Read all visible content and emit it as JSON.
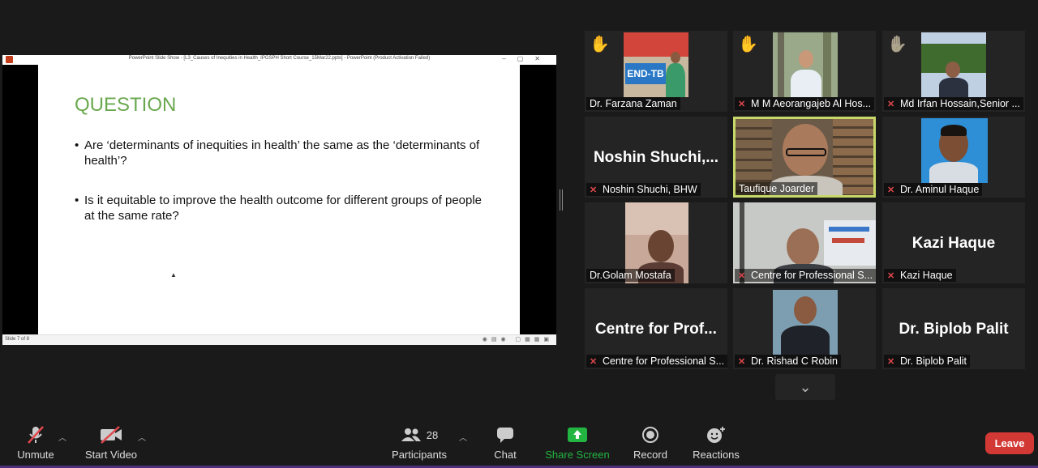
{
  "share": {
    "window_title": "PowerPoint Slide Show - [L3_Causes of Inequities in Health_IPGSPH Short Course_15Mar22.pptx] - PowerPoint (Product Activation Failed)",
    "slide_heading": "QUESTION",
    "bullets": [
      "Are ‘determinants of inequities in health’ the same as the ‘determinants of health’?",
      "Is it equitable to improve the health outcome for different groups of people at the same rate?"
    ],
    "slide_status": "Slide 7 of 8"
  },
  "gallery": {
    "tiles": [
      {
        "name": "Dr. Farzana Zaman",
        "muted": false,
        "hand": true,
        "big_name": ""
      },
      {
        "name": "M M Aeorangajeb Al Hos...",
        "muted": true,
        "hand": true,
        "big_name": ""
      },
      {
        "name": "Md Irfan Hossain,Senior ...",
        "muted": true,
        "hand": true,
        "big_name": ""
      },
      {
        "name": "Noshin Shuchi, BHW",
        "muted": true,
        "hand": false,
        "big_name": "Noshin Shuchi,..."
      },
      {
        "name": "Taufique Joarder",
        "muted": false,
        "hand": false,
        "big_name": ""
      },
      {
        "name": "Dr. Aminul Haque",
        "muted": true,
        "hand": false,
        "big_name": ""
      },
      {
        "name": "Dr.Golam Mostafa",
        "muted": false,
        "hand": false,
        "big_name": ""
      },
      {
        "name": "Centre for Professional S...",
        "muted": true,
        "hand": false,
        "big_name": ""
      },
      {
        "name": "Kazi Haque",
        "muted": true,
        "hand": false,
        "big_name": "Kazi Haque"
      },
      {
        "name": "Centre for Professional S...",
        "muted": true,
        "hand": false,
        "big_name": "Centre for Prof..."
      },
      {
        "name": "Dr. Rishad C Robin",
        "muted": true,
        "hand": false,
        "big_name": ""
      },
      {
        "name": "Dr. Biplob Palit",
        "muted": true,
        "hand": false,
        "big_name": "Dr. Biplob Palit"
      }
    ],
    "speaking_color": "#c6d86a"
  },
  "toolbar": {
    "unmute": "Unmute",
    "start_video": "Start Video",
    "participants": "Participants",
    "participants_count": "28",
    "chat": "Chat",
    "share_screen": "Share Screen",
    "record": "Record",
    "reactions": "Reactions",
    "leave": "Leave"
  },
  "icons": [
    "mic-muted-icon",
    "video-off-icon",
    "participants-icon",
    "chat-icon",
    "share-screen-icon",
    "record-icon",
    "reactions-icon",
    "raised-hand-icon",
    "chevron-down-icon"
  ],
  "colors": {
    "accent_green": "#23b541",
    "leave_red": "#d23935",
    "mute_red": "#e0474c",
    "slide_heading": "#6aa84f"
  }
}
